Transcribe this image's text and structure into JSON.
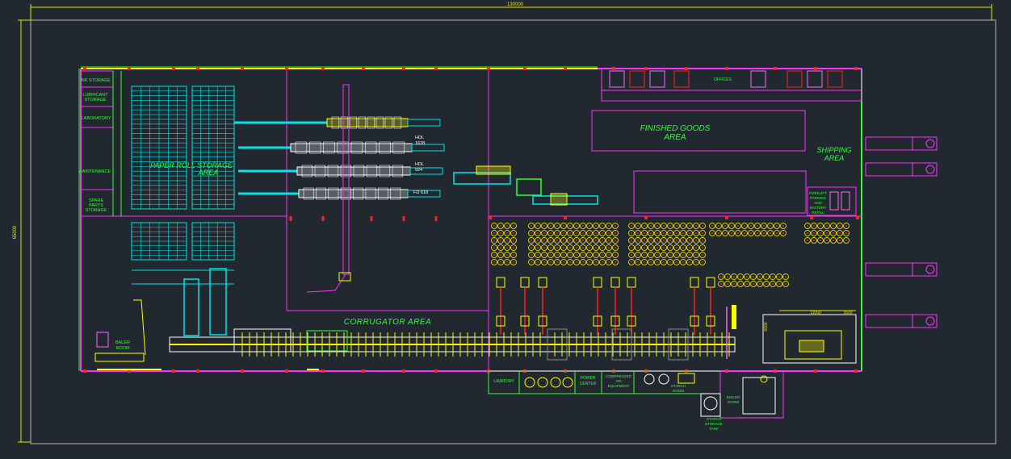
{
  "drawing": {
    "overall_width_dim": "130000",
    "overall_height_dim": "65000",
    "colors": {
      "background": "#212830",
      "sheet_border": "#b8b8b8",
      "dimension": "#e6e600",
      "wall": "#ff33ff",
      "label": "#33ff33",
      "rack": "#00e5e5",
      "machine": "#ffff00",
      "column": "#ff2020",
      "equipment": "#ff66ff",
      "white": "#ffffff"
    }
  },
  "areas": {
    "ink_storage": "INK STORAGE",
    "lubricant_storage_1": "LUBRICANT",
    "lubricant_storage_2": "STORAGE",
    "laboratory": "LABORATORY",
    "maintenance": "MAINTENANCE",
    "spare_parts_1": "SPARE",
    "spare_parts_2": "PARTS",
    "spare_parts_3": "STORAGE",
    "paper_storage_1": "PAPER ROLL STORAGE",
    "paper_storage_2": "AREA",
    "finished_goods_1": "FINISHED GOODS",
    "finished_goods_2": "AREA",
    "shipping_1": "SHIPPING",
    "shipping_2": "AREA",
    "forklift_1": "FORKLIFT",
    "forklift_2": "PARKING",
    "forklift_3": "AND",
    "forklift_4": "BATTERY",
    "forklift_5": "REFILL",
    "offices": "OFFICES",
    "corrugator": "CORRUGATOR AREA",
    "baler_1": "BALER",
    "baler_2": "ROOM",
    "lavatory": "LAVATORY",
    "power_center_1": "POWER",
    "power_center_2": "CENTER",
    "compressed_air_1": "COMPRESSED",
    "compressed_air_2": "AIR",
    "compressed_air_3": "EQUIPMENT",
    "starch_room_1": "STARCH",
    "starch_room_2": "ROOM",
    "boiler_room_1": "BOILER",
    "boiler_room_2": "ROOM",
    "starch_storage_1": "STARCH",
    "starch_storage_2": "STORAGE",
    "starch_storage_3": "TANK"
  },
  "machines": {
    "hdl_1": "HDL",
    "hdl_1_num": "1628",
    "hdl_2": "HDL",
    "hdl_2_num": "924",
    "fd": "FD 618"
  },
  "dimensions": {
    "d1": "11050",
    "d2": "3500",
    "d3": "6000"
  }
}
